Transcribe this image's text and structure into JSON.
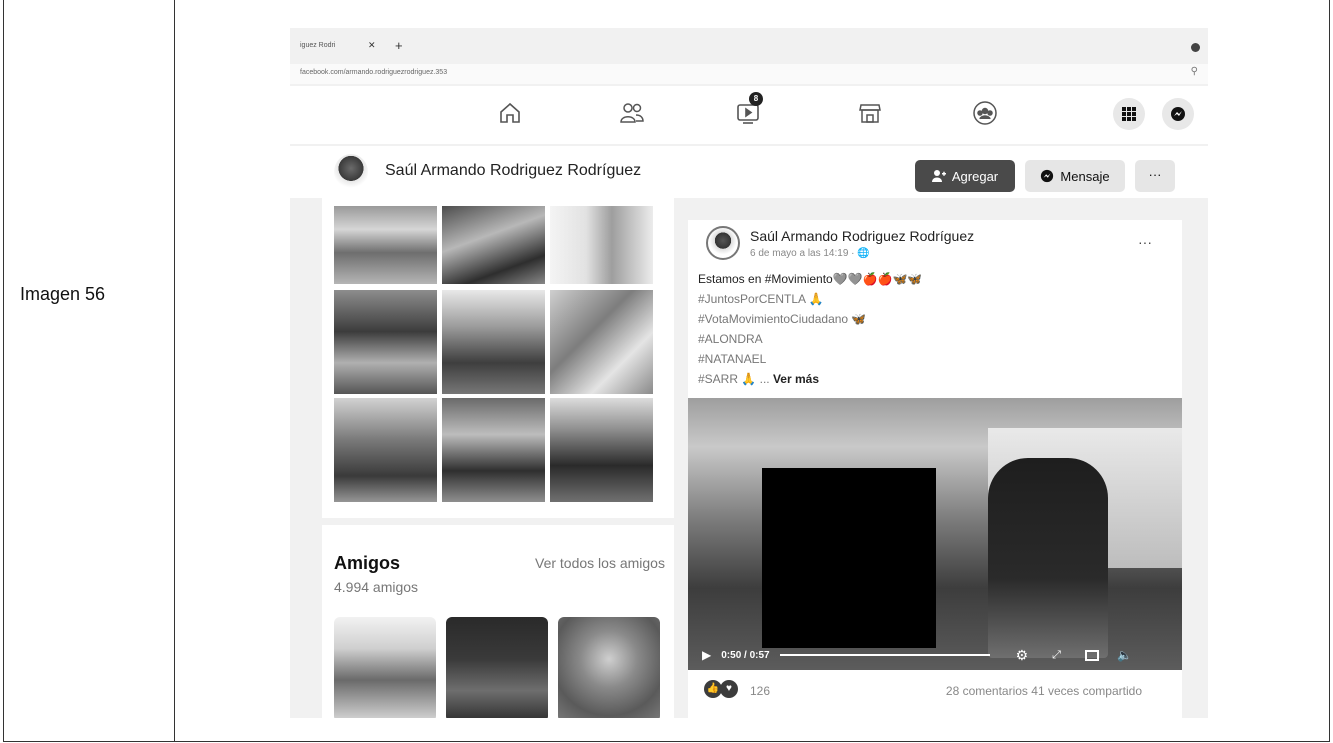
{
  "document": {
    "row_label": "Imagen 56"
  },
  "browser": {
    "tab_title": "iguez Rodri",
    "url": "facebook.com/armando.rodriguezrodriguez.353"
  },
  "nav": {
    "watch_badge": "8"
  },
  "profile": {
    "name": "Saúl Armando Rodriguez Rodríguez",
    "add_label": "Agregar",
    "message_label": "Mensaje",
    "more_label": "···"
  },
  "friends": {
    "title": "Amigos",
    "see_all": "Ver todos los amigos",
    "count": "4.994 amigos"
  },
  "post": {
    "author": "Saúl Armando Rodriguez Rodríguez",
    "date": "6 de mayo a las 14:19 · ",
    "more": "···",
    "line1": "Estamos en #Movimiento🩶🩶🍎🍎🦋🦋",
    "line2": "#JuntosPorCENTLA 🙏",
    "line3": "#VotaMovimientoCiudadano 🦋",
    "line4": "#ALONDRA",
    "line5": "#NATANAEL",
    "line6": "#SARR 🙏 ...",
    "see_more": "Ver más",
    "video_time": "0:50 / 0:57",
    "reaction_count": "126",
    "comments_shares": "28 comentarios  41 veces compartido"
  },
  "colors": {
    "background": "#f1f1f1",
    "card": "#ffffff",
    "button_dark": "#4a4a4a"
  }
}
